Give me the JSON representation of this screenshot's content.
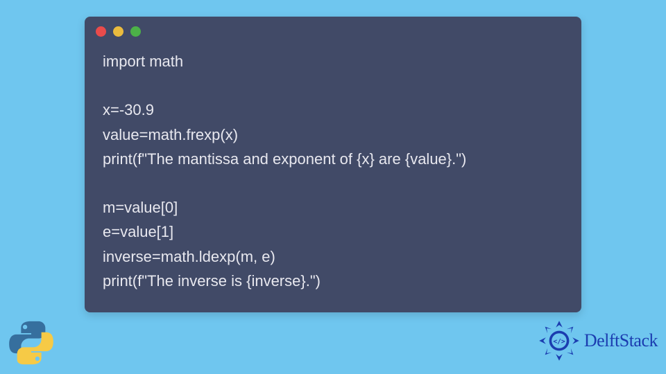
{
  "code": {
    "lines": [
      "import math",
      "",
      "x=-30.9",
      "value=math.frexp(x)",
      "print(f\"The mantissa and exponent of {x} are {value}.\")",
      "",
      "m=value[0]",
      "e=value[1]",
      "inverse=math.ldexp(m, e)",
      "print(f\"The inverse is {inverse}.\")"
    ]
  },
  "branding": {
    "delft_label": "DelftStack"
  },
  "colors": {
    "background": "#6fc6ef",
    "window": "#414a67",
    "code_text": "#e8e8ef",
    "delft_blue": "#1b3db0",
    "dot_red": "#e94b4b",
    "dot_yellow": "#eabb3e",
    "dot_green": "#4cb148"
  }
}
